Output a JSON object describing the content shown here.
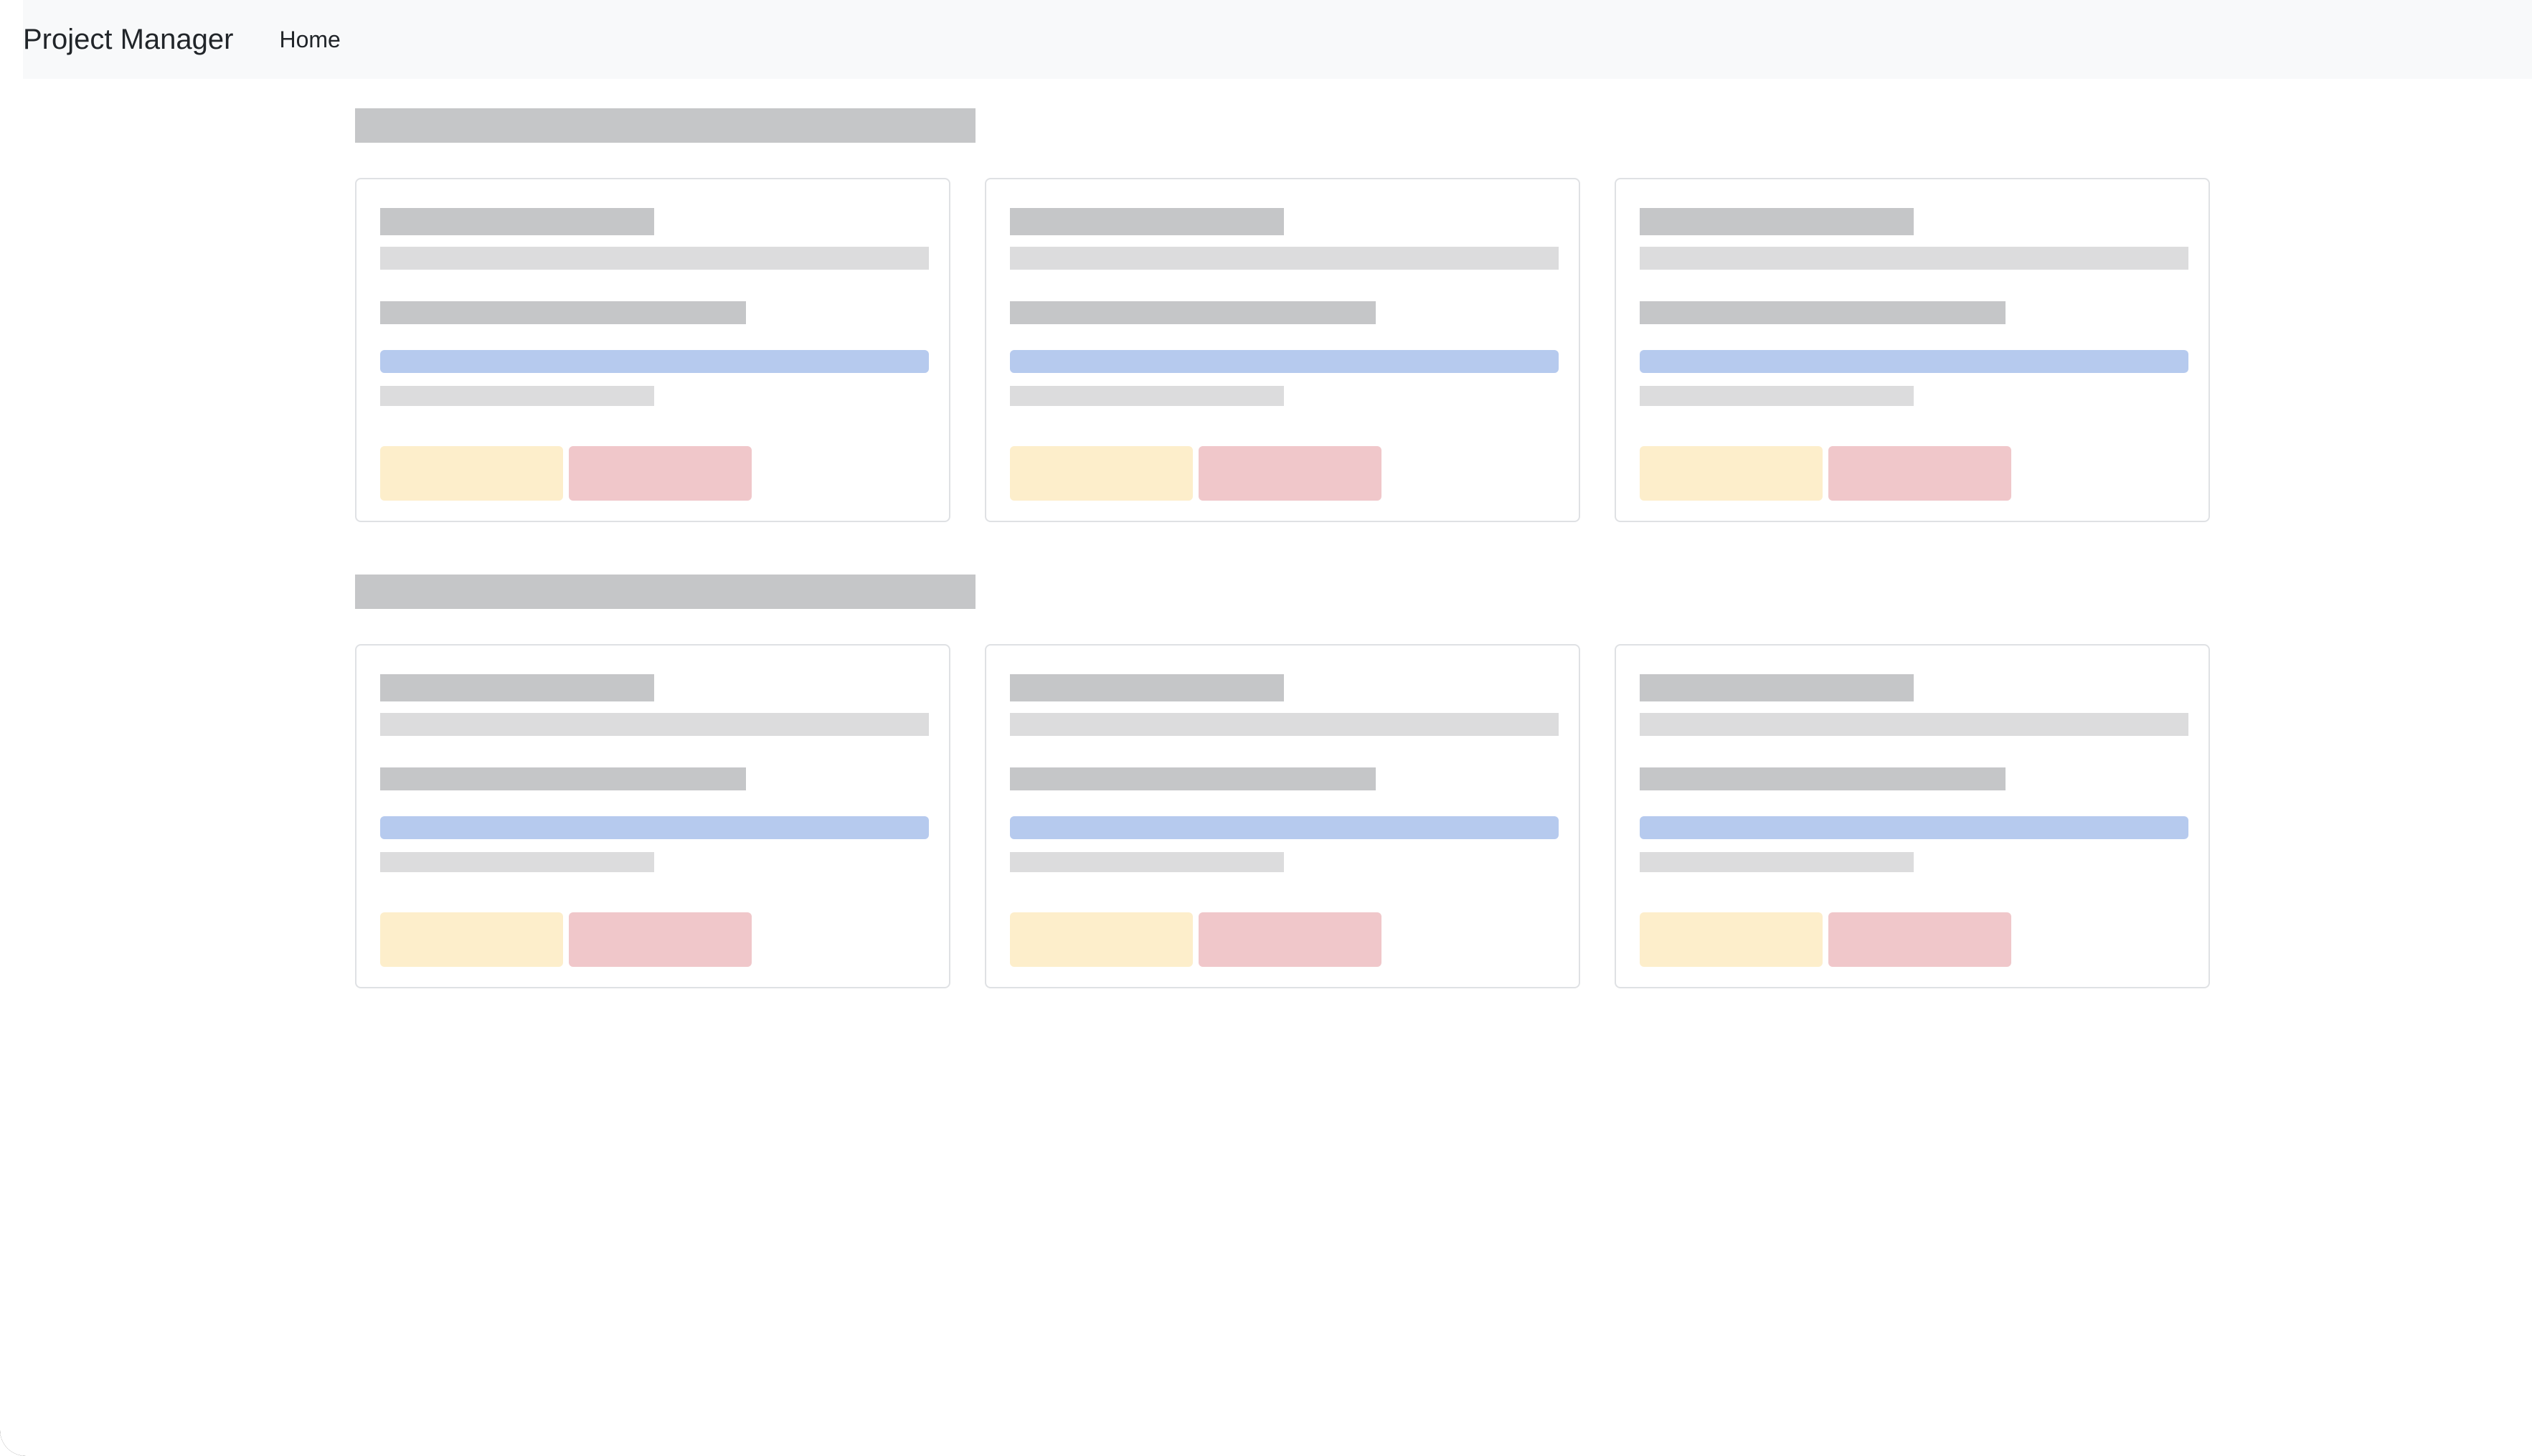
{
  "navbar": {
    "brand": "Project Manager",
    "links": [
      {
        "label": "Home"
      }
    ]
  },
  "colors": {
    "navbar_bg": "#f8f9fa",
    "placeholder_dark": "#c5c6c8",
    "placeholder_light": "#dcdcdd",
    "placeholder_progress": "#b6caee",
    "placeholder_warning_button": "#fdeecb",
    "placeholder_danger_button": "#f0c7ca"
  },
  "sections": [
    {
      "cards": [
        {},
        {},
        {}
      ]
    },
    {
      "cards": [
        {},
        {},
        {}
      ]
    }
  ]
}
